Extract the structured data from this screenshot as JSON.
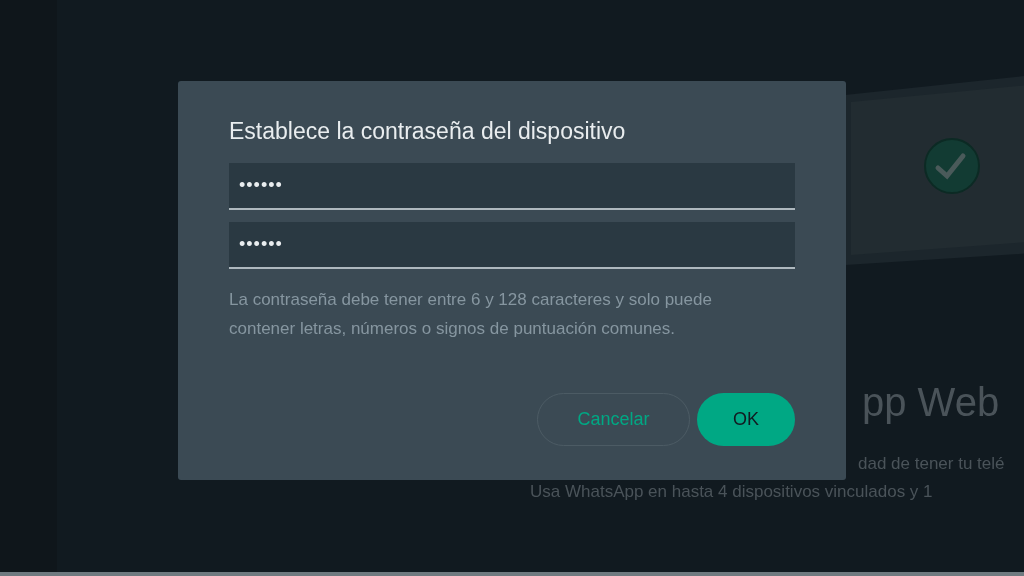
{
  "background": {
    "title": "pp Web",
    "lines": [
      "dad de tener tu telé",
      "Usa WhatsApp en hasta 4 dispositivos vinculados y 1"
    ]
  },
  "dialog": {
    "title": "Establece la contraseña del dispositivo",
    "fields": [
      {
        "value": "••••••"
      },
      {
        "value": "••••••"
      }
    ],
    "hint": "La contraseña debe tener entre 6 y 128 caracteres y solo puede contener letras, números o signos de puntuación comunes.",
    "buttons": [
      {
        "label": "Cancelar",
        "kind": "secondary"
      },
      {
        "label": "OK",
        "kind": "primary"
      }
    ]
  }
}
